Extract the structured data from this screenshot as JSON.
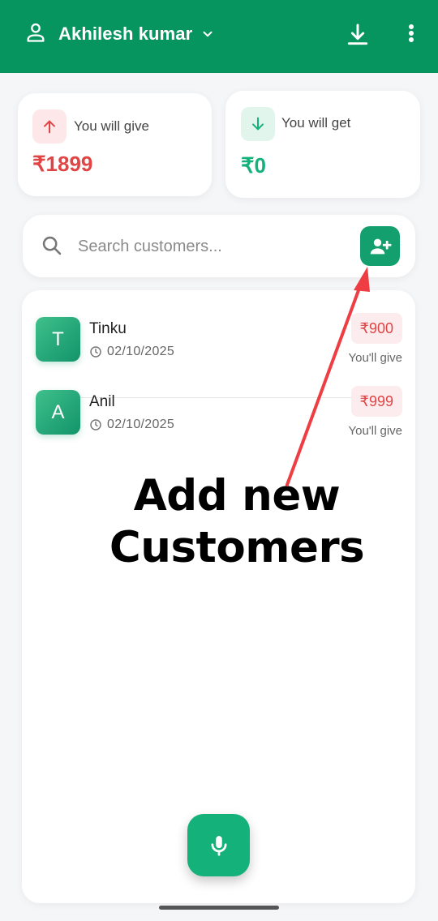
{
  "header": {
    "user_name": "Akhilesh kumar"
  },
  "summary": {
    "give_label": "You will give",
    "give_amount": "₹1899",
    "get_label": "You will get",
    "get_amount": "₹0"
  },
  "search": {
    "placeholder": "Search customers...",
    "value": ""
  },
  "customers": [
    {
      "initial": "T",
      "name": "Tinku",
      "date": "02/10/2025",
      "amount": "₹900",
      "note": "You'll give"
    },
    {
      "initial": "A",
      "name": "Anil",
      "date": "02/10/2025",
      "amount": "₹999",
      "note": "You'll give"
    }
  ],
  "annotation": {
    "line1": "Add new",
    "line2": "Customers"
  },
  "colors": {
    "primary": "#07955f",
    "accent_green": "#14b27a",
    "give_red": "#e04444",
    "arrow_red": "#ee3e43"
  },
  "icons": {
    "user": "person-outline-icon",
    "dropdown": "chevron-down-icon",
    "download": "download-icon",
    "more": "more-vertical-icon",
    "give": "arrow-up-icon",
    "get": "arrow-down-icon",
    "search": "search-icon",
    "add_customer": "person-add-icon",
    "time": "clock-icon",
    "mic": "microphone-icon"
  }
}
